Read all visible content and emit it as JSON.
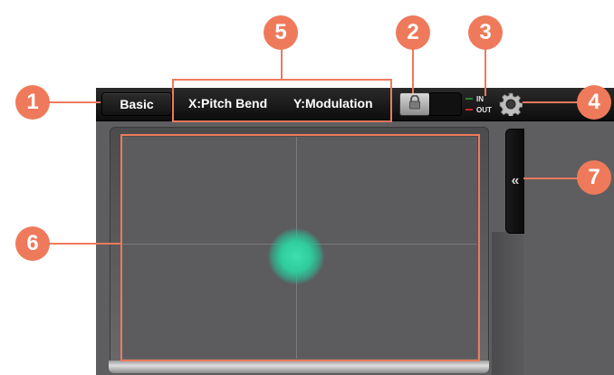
{
  "topbar": {
    "mode_label": "Basic",
    "x_axis_label": "X:Pitch Bend",
    "y_axis_label": "Y:Modulation",
    "midi_in_label": "IN",
    "midi_out_label": "OUT",
    "lock_icon": "lock-icon",
    "settings_icon": "gear-icon"
  },
  "pad": {
    "touch_point_color": "#33d6a6"
  },
  "side_tab": {
    "label": "«"
  },
  "callouts": {
    "c1": "1",
    "c2": "2",
    "c3": "3",
    "c4": "4",
    "c5": "5",
    "c6": "6",
    "c7": "7"
  },
  "colors": {
    "callout": "#ef7a5b",
    "pad": "#5c5c5e",
    "toolbar": "#141414"
  }
}
